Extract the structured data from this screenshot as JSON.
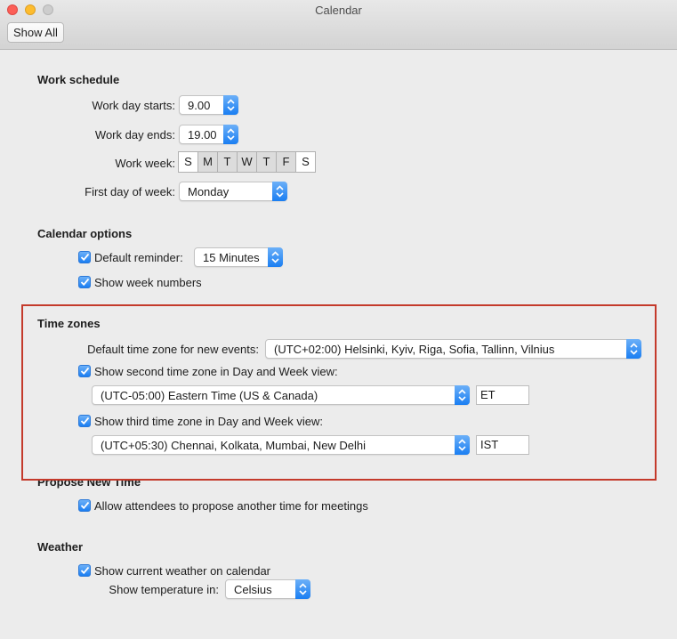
{
  "window": {
    "title": "Calendar",
    "show_all": "Show All"
  },
  "work_schedule": {
    "title": "Work schedule",
    "day_starts_label": "Work day starts:",
    "day_starts_value": "9.00",
    "day_ends_label": "Work day ends:",
    "day_ends_value": "19.00",
    "work_week_label": "Work week:",
    "days": [
      "S",
      "M",
      "T",
      "W",
      "T",
      "F",
      "S"
    ],
    "first_day_label": "First day of week:",
    "first_day_value": "Monday"
  },
  "calendar_options": {
    "title": "Calendar options",
    "default_reminder_label": "Default reminder:",
    "default_reminder_value": "15 Minutes",
    "week_numbers_label": "Show week numbers"
  },
  "time_zones": {
    "title": "Time zones",
    "default_tz_label": "Default time zone for new events:",
    "default_tz_value": "(UTC+02:00) Helsinki, Kyiv, Riga, Sofia, Tallinn, Vilnius",
    "second_tz_label": "Show second time zone in Day and Week view:",
    "second_tz_value": "(UTC-05:00) Eastern Time (US & Canada)",
    "second_tz_abbr": "ET",
    "third_tz_label": "Show third time zone in Day and Week view:",
    "third_tz_value": "(UTC+05:30) Chennai, Kolkata, Mumbai, New Delhi",
    "third_tz_abbr": "IST"
  },
  "propose": {
    "title": "Propose New Time",
    "allow_label": "Allow attendees to propose another time for meetings"
  },
  "weather": {
    "title": "Weather",
    "show_weather_label": "Show current weather on calendar",
    "temp_label": "Show temperature in:",
    "temp_value": "Celsius"
  },
  "colors": {
    "accent": "#1a7ef2",
    "highlight_box": "#c43a2b"
  }
}
